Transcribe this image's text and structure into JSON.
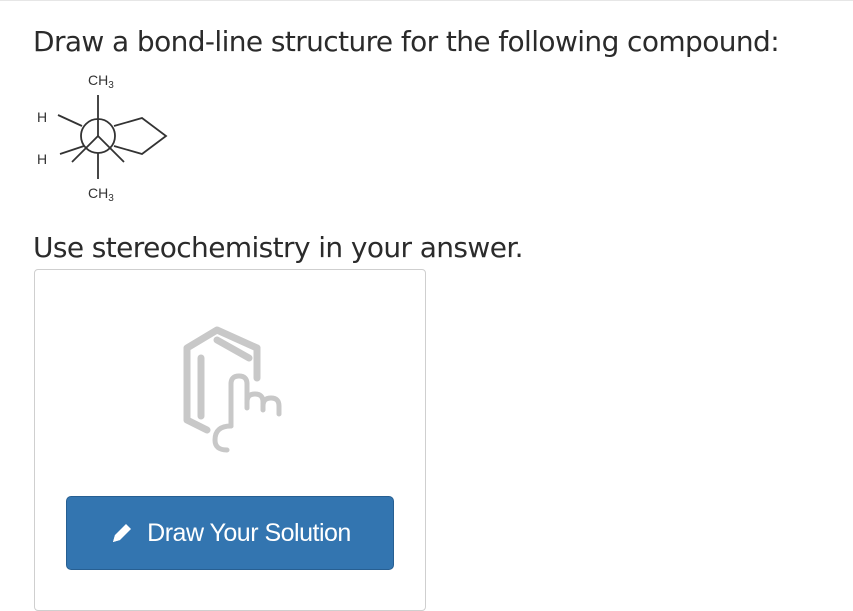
{
  "question": {
    "text": "Draw a bond-line structure for the following compound:"
  },
  "molecule": {
    "labels": {
      "top": {
        "main": "CH",
        "sub": "3"
      },
      "bottom": {
        "main": "CH",
        "sub": "3"
      },
      "h_upper": "H",
      "h_lower": "H"
    }
  },
  "instruction": {
    "text": "Use stereochemistry in your answer."
  },
  "answer_panel": {
    "graphic_icon": "draw-structure-icon",
    "button": {
      "icon": "pencil-icon",
      "label": "Draw Your Solution"
    }
  },
  "colors": {
    "button_bg": "#3375b0",
    "button_text": "#ffffff",
    "graphic_gray": "#c8c8c8",
    "text": "#2b2b2b"
  }
}
